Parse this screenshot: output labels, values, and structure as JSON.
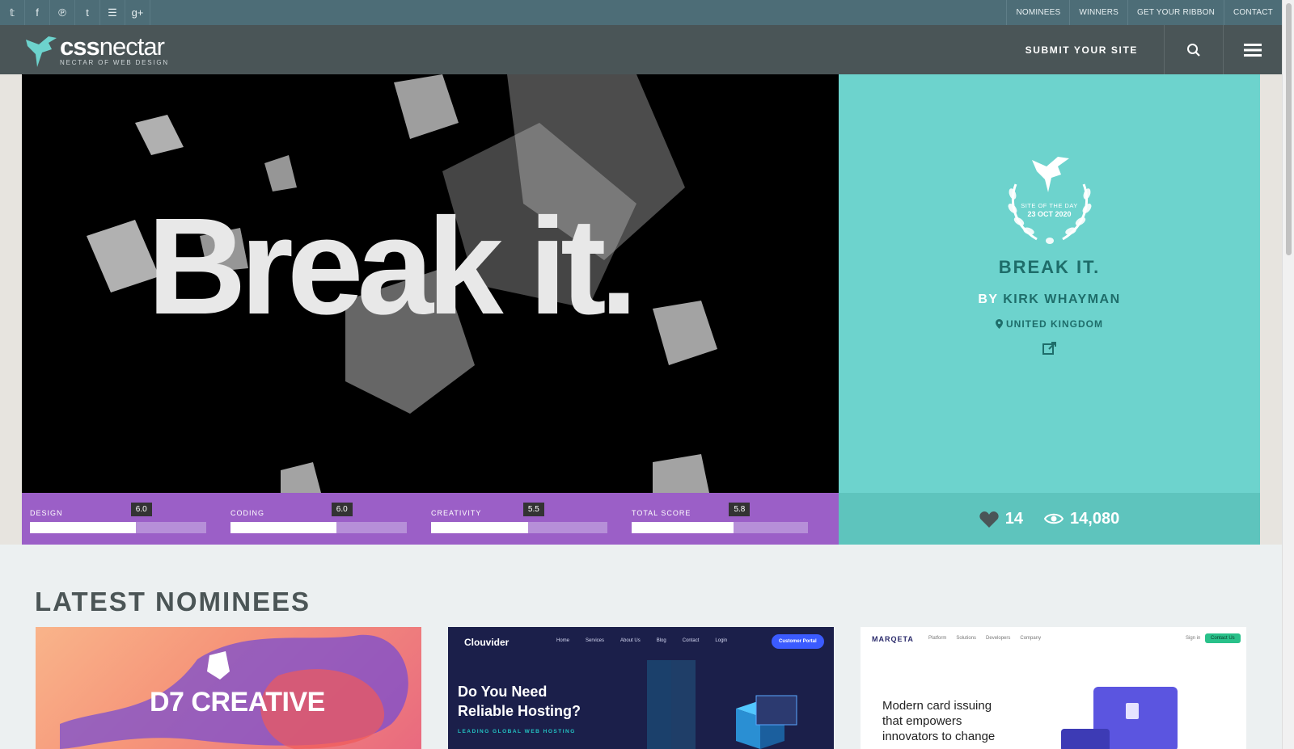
{
  "topbar": {
    "social": [
      {
        "name": "twitter-icon",
        "glyph": "𝕥"
      },
      {
        "name": "facebook-icon",
        "glyph": "f"
      },
      {
        "name": "pinterest-icon",
        "glyph": "℗"
      },
      {
        "name": "tumblr-icon",
        "glyph": "t"
      },
      {
        "name": "rss-icon",
        "glyph": "☰"
      },
      {
        "name": "google-plus-icon",
        "glyph": "g+"
      }
    ],
    "nav": [
      "NOMINEES",
      "WINNERS",
      "GET YOUR RIBBON",
      "CONTACT"
    ]
  },
  "header": {
    "logo_main_bold": "css",
    "logo_main_thin": "nectar",
    "logo_sub": "NECTAR OF WEB DESIGN",
    "submit_label": "SUBMIT YOUR SITE"
  },
  "hero": {
    "image_text": "Break it.",
    "scores": [
      {
        "label": "DESIGN",
        "value": "6.0",
        "fraction": 0.6
      },
      {
        "label": "CODING",
        "value": "6.0",
        "fraction": 0.6
      },
      {
        "label": "CREATIVITY",
        "value": "5.5",
        "fraction": 0.55
      },
      {
        "label": "TOTAL SCORE",
        "value": "5.8",
        "fraction": 0.58
      }
    ]
  },
  "panel": {
    "badge_line1": "SITE OF THE DAY",
    "badge_line2": "23 OCT 2020",
    "site_title": "BREAK IT.",
    "by_label": "BY",
    "author": "KIRK WHAYMAN",
    "location": "UNITED KINGDOM",
    "likes": "14",
    "views": "14,080"
  },
  "latest": {
    "title": "LATEST NOMINEES",
    "cards": [
      {
        "title": "D7 CREATIVE"
      },
      {
        "brand": "Clouvider",
        "headline1": "Do You Need",
        "headline2": "Reliable Hosting?",
        "sub": "LEADING GLOBAL WEB HOSTING",
        "nav": [
          "Home",
          "Services",
          "About Us",
          "Blog",
          "Contact",
          "Login"
        ],
        "cta": "Customer Portal"
      },
      {
        "brand": "MARQETA",
        "nav": [
          "Platform",
          "Solutions",
          "Developers",
          "Company"
        ],
        "signin": "Sign in",
        "cta": "Contact Us",
        "headline1": "Modern card issuing",
        "headline2": "that empowers",
        "headline3": "innovators to change"
      }
    ]
  },
  "colors": {
    "topbar": "#4d6d77",
    "header": "#4a5557",
    "score_bar": "#9b5fc7",
    "panel": "#6dd3cd",
    "panel_dark_text": "#1e6d6a"
  }
}
